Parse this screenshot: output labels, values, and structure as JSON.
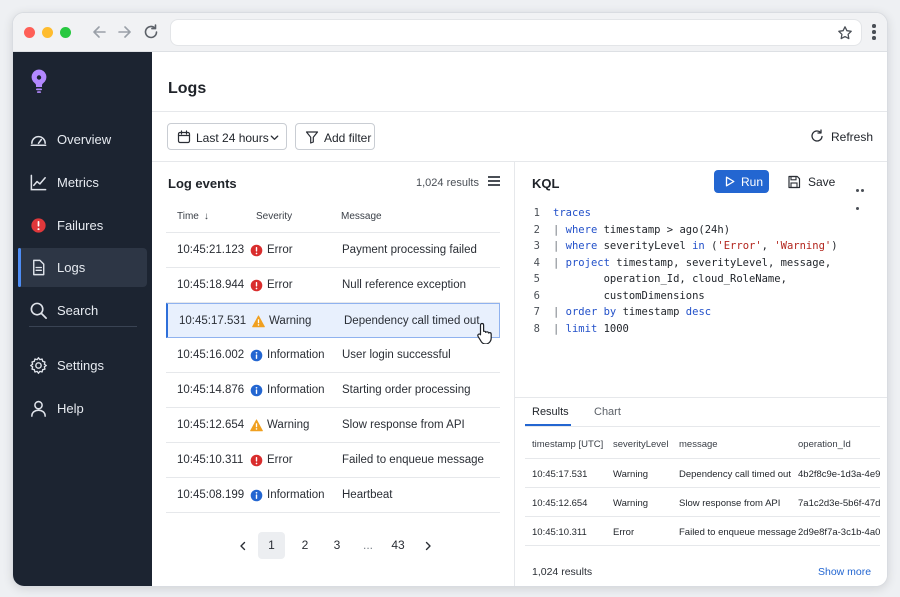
{
  "colors": {
    "sidebar_bg": "#1c2431",
    "accent": "#2366d1",
    "error": "#d92d2d",
    "warning": "#f0a020",
    "info": "#2366d1",
    "logo": "#b388ff"
  },
  "sidebar": {
    "logo_icon": "lightbulb-icon",
    "items": [
      {
        "label": "Overview",
        "icon": "dashboard-gauge-icon"
      },
      {
        "label": "Metrics",
        "icon": "line-chart-icon"
      },
      {
        "label": "Failures",
        "icon": "error-circle-icon"
      },
      {
        "label": "Logs",
        "icon": "document-icon",
        "active": true
      },
      {
        "label": "Search",
        "icon": "search-icon"
      },
      {
        "label": "Settings",
        "icon": "gear-icon"
      },
      {
        "label": "Help",
        "icon": "person-icon"
      }
    ]
  },
  "header": {
    "title": "Logs",
    "time_range_label": "Last 24 hours",
    "add_filter_label": "Add filter",
    "refresh_label": "Refresh"
  },
  "log_events": {
    "title": "Log events",
    "count": "1,024 results",
    "columns": [
      "Time",
      "Severity",
      "Message"
    ],
    "rows": [
      {
        "time": "10:45:21.123",
        "severity": "Error",
        "message": "Payment processing failed"
      },
      {
        "time": "10:45:18.944",
        "severity": "Error",
        "message": "Null reference exception"
      },
      {
        "time": "10:45:17.531",
        "severity": "Warning",
        "message": "Dependency call timed out",
        "selected": true
      },
      {
        "time": "10:45:16.002",
        "severity": "Information",
        "message": "User login successful"
      },
      {
        "time": "10:45:14.876",
        "severity": "Information",
        "message": "Starting order processing"
      },
      {
        "time": "10:45:12.654",
        "severity": "Warning",
        "message": "Slow response from API"
      },
      {
        "time": "10:45:10.311",
        "severity": "Error",
        "message": "Failed to enqueue message"
      },
      {
        "time": "10:45:08.199",
        "severity": "Information",
        "message": "Heartbeat"
      }
    ],
    "pagination": {
      "current": "1",
      "pages": [
        "1",
        "2",
        "3",
        "...",
        "43"
      ]
    }
  },
  "kql": {
    "title": "KQL",
    "run_label": "Run",
    "save_label": "Save",
    "lines": [
      {
        "num": "1",
        "text": "traces"
      },
      {
        "num": "2",
        "text": "| where timestamp > ago(24h)"
      },
      {
        "num": "3",
        "text": "| where severityLevel in ('Error', 'Warning')"
      },
      {
        "num": "4",
        "text": "| project timestamp, severityLevel, message,"
      },
      {
        "num": "5",
        "text": "        operation_Id, cloud_RoleName,"
      },
      {
        "num": "6",
        "text": "        customDimensions"
      },
      {
        "num": "7",
        "text": "| order by timestamp desc"
      },
      {
        "num": "8",
        "text": "| limit 1000"
      }
    ]
  },
  "results": {
    "tabs": [
      "Results",
      "Chart"
    ],
    "active_tab": "Results",
    "columns": [
      "timestamp [UTC]",
      "severityLevel",
      "message",
      "operation_Id"
    ],
    "rows": [
      [
        "10:45:17.531",
        "Warning",
        "Dependency call timed out",
        "4b2f8c9e-1d3a-4e9..."
      ],
      [
        "10:45:12.654",
        "Warning",
        "Slow response from API",
        "7a1c2d3e-5b6f-47d..."
      ],
      [
        "10:45:10.311",
        "Error",
        "Failed to enqueue message",
        "2d9e8f7a-3c1b-4a0..."
      ]
    ],
    "footer_count": "1,024 results",
    "show_more_label": "Show more"
  }
}
